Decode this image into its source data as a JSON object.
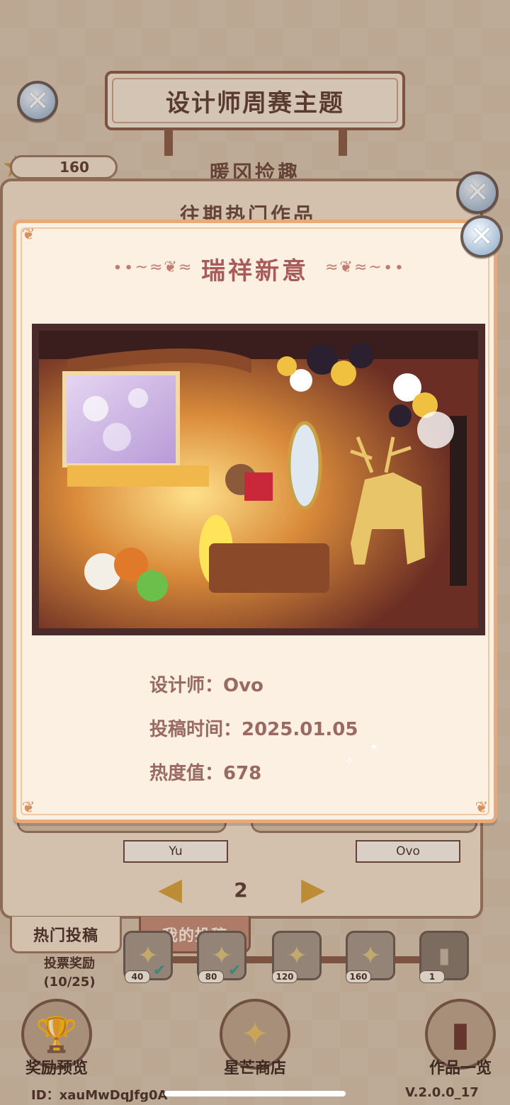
{
  "header": {
    "title": "设计师周赛主题",
    "subtitle": "暖冈捡趣",
    "star_count": "160"
  },
  "back_panel": {
    "heading": "往期热门作品",
    "designers": [
      "Yu",
      "Ovo"
    ],
    "page": "2"
  },
  "tabs": {
    "hot": "热门投稿",
    "mine": "我的投稿"
  },
  "vote": {
    "label": "投票奖励",
    "progress": "(10/25)",
    "progress_value": 10,
    "progress_max": 25,
    "rewards": [
      {
        "count": "40",
        "claimed": true
      },
      {
        "count": "80",
        "claimed": true
      },
      {
        "count": "120",
        "claimed": false
      },
      {
        "count": "160",
        "claimed": false
      },
      {
        "count": "1",
        "claimed": false
      }
    ]
  },
  "bottom_nav": {
    "reward_preview": "奖励预览",
    "star_shop": "星芒商店",
    "works_list": "作品一览"
  },
  "footer": {
    "id": "ID：xauMwDqJfg0A",
    "version": "V.2.0.0_17"
  },
  "modal": {
    "title": "瑞祥新意",
    "designer": "设计师：Ovo",
    "submit_time": "投稿时间：2025.01.05",
    "heat": "热度值：678"
  },
  "colors": {
    "modal_border": "#e7a977",
    "title_color": "#a85b58",
    "info_text": "#9a6a62",
    "checkmark": "#3b9d8f",
    "accent_gold": "#d9a33c"
  },
  "icons": [
    "close-icon",
    "star-icon",
    "arrow-left-icon",
    "arrow-right-icon",
    "check-icon",
    "snail-trophy-icon",
    "compass-star-icon",
    "book-icon"
  ]
}
